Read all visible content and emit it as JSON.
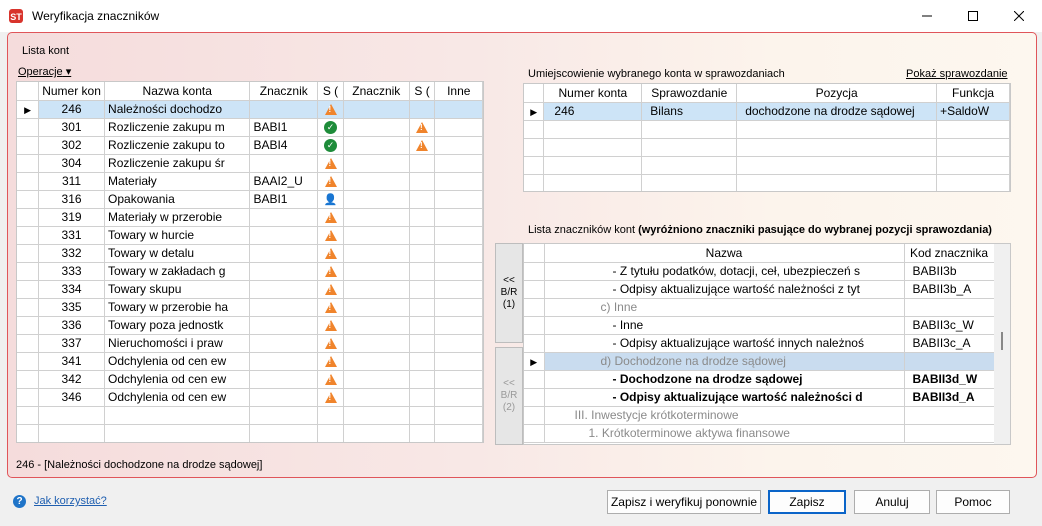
{
  "window": {
    "title": "Weryfikacja znaczników"
  },
  "left": {
    "section_label": "Lista kont",
    "operations_label": "Operacje",
    "columns": [
      "Numer kon",
      "Nazwa konta",
      "Znacznik",
      "S (",
      "Znacznik",
      "S (",
      "Inne"
    ],
    "rows": [
      {
        "num": "246",
        "name": "Należności dochodzo",
        "tag": "",
        "s1": "warn",
        "tag2": "",
        "s2": ""
      },
      {
        "num": "301",
        "name": "Rozliczenie zakupu m",
        "tag": "BABI1",
        "s1": "ok",
        "tag2": "",
        "s2": "warn"
      },
      {
        "num": "302",
        "name": "Rozliczenie zakupu to",
        "tag": "BABI4",
        "s1": "ok",
        "tag2": "",
        "s2": "warn"
      },
      {
        "num": "304",
        "name": "Rozliczenie zakupu śr",
        "tag": "",
        "s1": "warn",
        "tag2": "",
        "s2": ""
      },
      {
        "num": "311",
        "name": "Materiały",
        "tag": "BAAI2_U",
        "s1": "warn",
        "tag2": "",
        "s2": ""
      },
      {
        "num": "316",
        "name": "Opakowania",
        "tag": "BABI1",
        "s1": "user",
        "tag2": "",
        "s2": ""
      },
      {
        "num": "319",
        "name": "Materiały w przerobie",
        "tag": "",
        "s1": "warn",
        "tag2": "",
        "s2": ""
      },
      {
        "num": "331",
        "name": "Towary w hurcie",
        "tag": "",
        "s1": "warn",
        "tag2": "",
        "s2": ""
      },
      {
        "num": "332",
        "name": "Towary w detalu",
        "tag": "",
        "s1": "warn",
        "tag2": "",
        "s2": ""
      },
      {
        "num": "333",
        "name": "Towary w zakładach g",
        "tag": "",
        "s1": "warn",
        "tag2": "",
        "s2": ""
      },
      {
        "num": "334",
        "name": "Towary skupu",
        "tag": "",
        "s1": "warn",
        "tag2": "",
        "s2": ""
      },
      {
        "num": "335",
        "name": "Towary w przerobie ha",
        "tag": "",
        "s1": "warn",
        "tag2": "",
        "s2": ""
      },
      {
        "num": "336",
        "name": "Towary poza jednostk",
        "tag": "",
        "s1": "warn",
        "tag2": "",
        "s2": ""
      },
      {
        "num": "337",
        "name": "Nieruchomości i praw",
        "tag": "",
        "s1": "warn",
        "tag2": "",
        "s2": ""
      },
      {
        "num": "341",
        "name": "Odchylenia od cen ew",
        "tag": "",
        "s1": "warn",
        "tag2": "",
        "s2": ""
      },
      {
        "num": "342",
        "name": "Odchylenia od cen ew",
        "tag": "",
        "s1": "warn",
        "tag2": "",
        "s2": ""
      },
      {
        "num": "346",
        "name": "Odchylenia od cen ew",
        "tag": "",
        "s1": "warn",
        "tag2": "",
        "s2": ""
      }
    ],
    "status": "246 - [Należności dochodzone na drodze sądowej]"
  },
  "right_top": {
    "label": "Umiejscowienie wybranego konta w sprawozdaniach",
    "show_link": "Pokaż sprawozdanie",
    "columns": [
      "Numer konta",
      "Sprawozdanie",
      "Pozycja",
      "Funkcja"
    ],
    "rows": [
      {
        "num": "246",
        "report": "Bilans",
        "position": "dochodzone na drodze sądowej",
        "func": "+SaldoW"
      }
    ]
  },
  "right_bottom": {
    "label_prefix": "Lista znaczników kont ",
    "label_bold": "(wyróżniono znaczniki pasujące do wybranej pozycji sprawozdania)",
    "columns": [
      "Nazwa",
      "Kod znacznika"
    ],
    "rows": [
      {
        "name": "- Z tytułu podatków, dotacji, ceł, ubezpieczeń s",
        "code": "BABII3b",
        "style": "normal",
        "indent": 68
      },
      {
        "name": "- Odpisy aktualizujące wartość należności z tyt",
        "code": "BABII3b_A",
        "style": "normal",
        "indent": 68
      },
      {
        "name": "c) Inne",
        "code": "",
        "style": "grey",
        "indent": 56
      },
      {
        "name": "- Inne",
        "code": "BABII3c_W",
        "style": "normal",
        "indent": 68
      },
      {
        "name": "- Odpisy aktualizujące wartość innych należnoś",
        "code": "BABII3c_A",
        "style": "normal",
        "indent": 68
      },
      {
        "name": "d) Dochodzone na drodze sądowej",
        "code": "",
        "style": "selgrey",
        "indent": 56
      },
      {
        "name": "- Dochodzone na drodze sądowej",
        "code": "BABII3d_W",
        "style": "bold",
        "indent": 68
      },
      {
        "name": "- Odpisy aktualizujące wartość należności d",
        "code": "BABII3d_A",
        "style": "bold",
        "indent": 68
      },
      {
        "name": "III. Inwestycje krótkoterminowe",
        "code": "",
        "style": "grey",
        "indent": 30
      },
      {
        "name": "1. Krótkoterminowe aktywa finansowe",
        "code": "",
        "style": "grey",
        "indent": 44
      }
    ],
    "btn1": [
      "<<",
      "B/R",
      "(1)"
    ],
    "btn2": [
      "<<",
      "B/R",
      "(2)"
    ]
  },
  "footer": {
    "help_link": "Jak korzystać?",
    "buttons": [
      "Zapisz i weryfikuj ponownie",
      "Zapisz",
      "Anuluj",
      "Pomoc"
    ]
  }
}
